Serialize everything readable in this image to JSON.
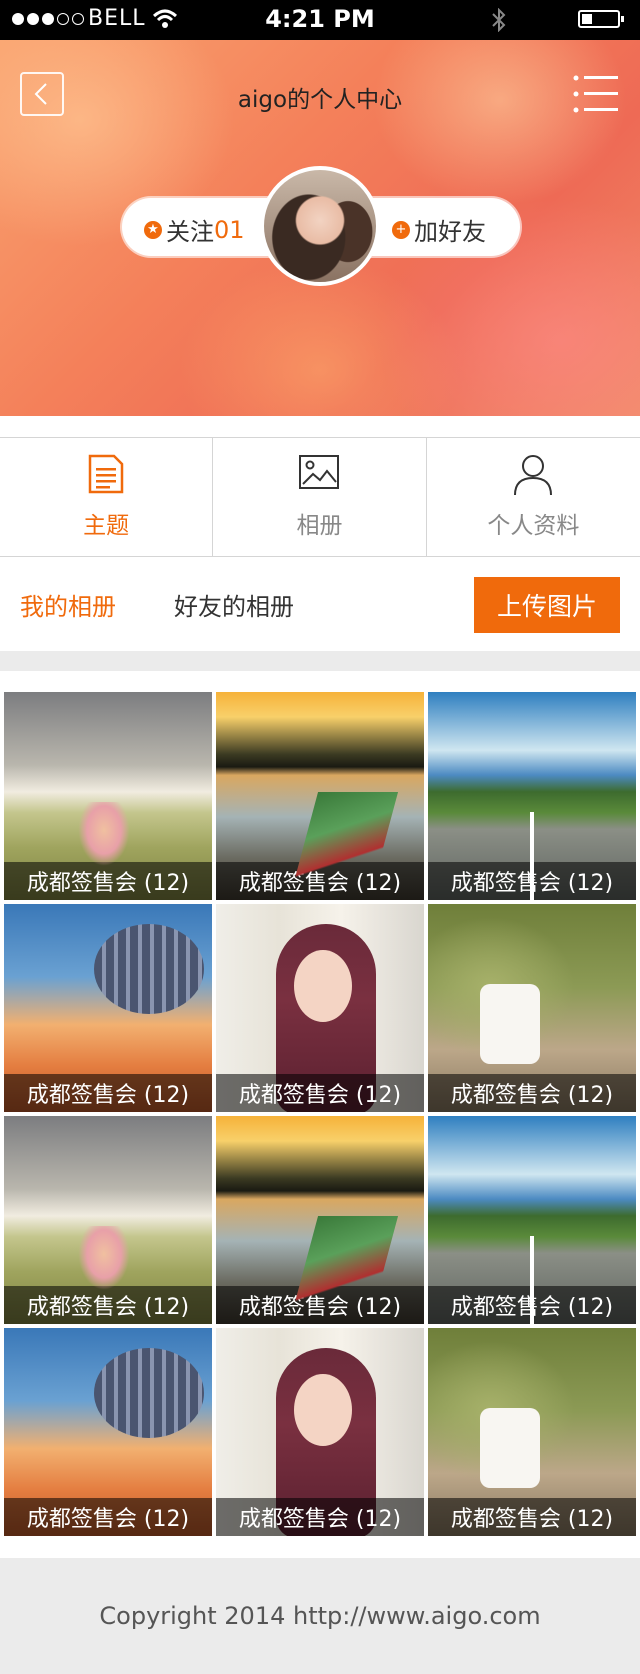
{
  "status_bar": {
    "carrier": "BELL",
    "time": "4:21 PM"
  },
  "header": {
    "title": "aigo的个人中心",
    "follow_label": "关注",
    "follow_count": "01",
    "add_friend_label": "加好友"
  },
  "tabs": [
    {
      "label": "主题",
      "icon": "document-icon",
      "active": true
    },
    {
      "label": "相册",
      "icon": "image-icon",
      "active": false
    },
    {
      "label": "个人资料",
      "icon": "person-icon",
      "active": false
    }
  ],
  "album_bar": {
    "my_albums": "我的相册",
    "friends_albums": "好友的相册",
    "upload_button": "上传图片"
  },
  "albums": [
    {
      "caption": "成都签售会 (12)"
    },
    {
      "caption": "成都签售会 (12)"
    },
    {
      "caption": "成都签售会 (12)"
    },
    {
      "caption": "成都签售会 (12)"
    },
    {
      "caption": "成都签售会 (12)"
    },
    {
      "caption": "成都签售会 (12)"
    },
    {
      "caption": "成都签售会 (12)"
    },
    {
      "caption": "成都签售会 (12)"
    },
    {
      "caption": "成都签售会 (12)"
    },
    {
      "caption": "成都签售会 (12)"
    },
    {
      "caption": "成都签售会 (12)"
    },
    {
      "caption": "成都签售会 (12)"
    }
  ],
  "footer": {
    "copyright": "Copyright 2014 http://www.aigo.com"
  },
  "colors": {
    "accent": "#f06a0c",
    "separator": "#ebebeb"
  }
}
